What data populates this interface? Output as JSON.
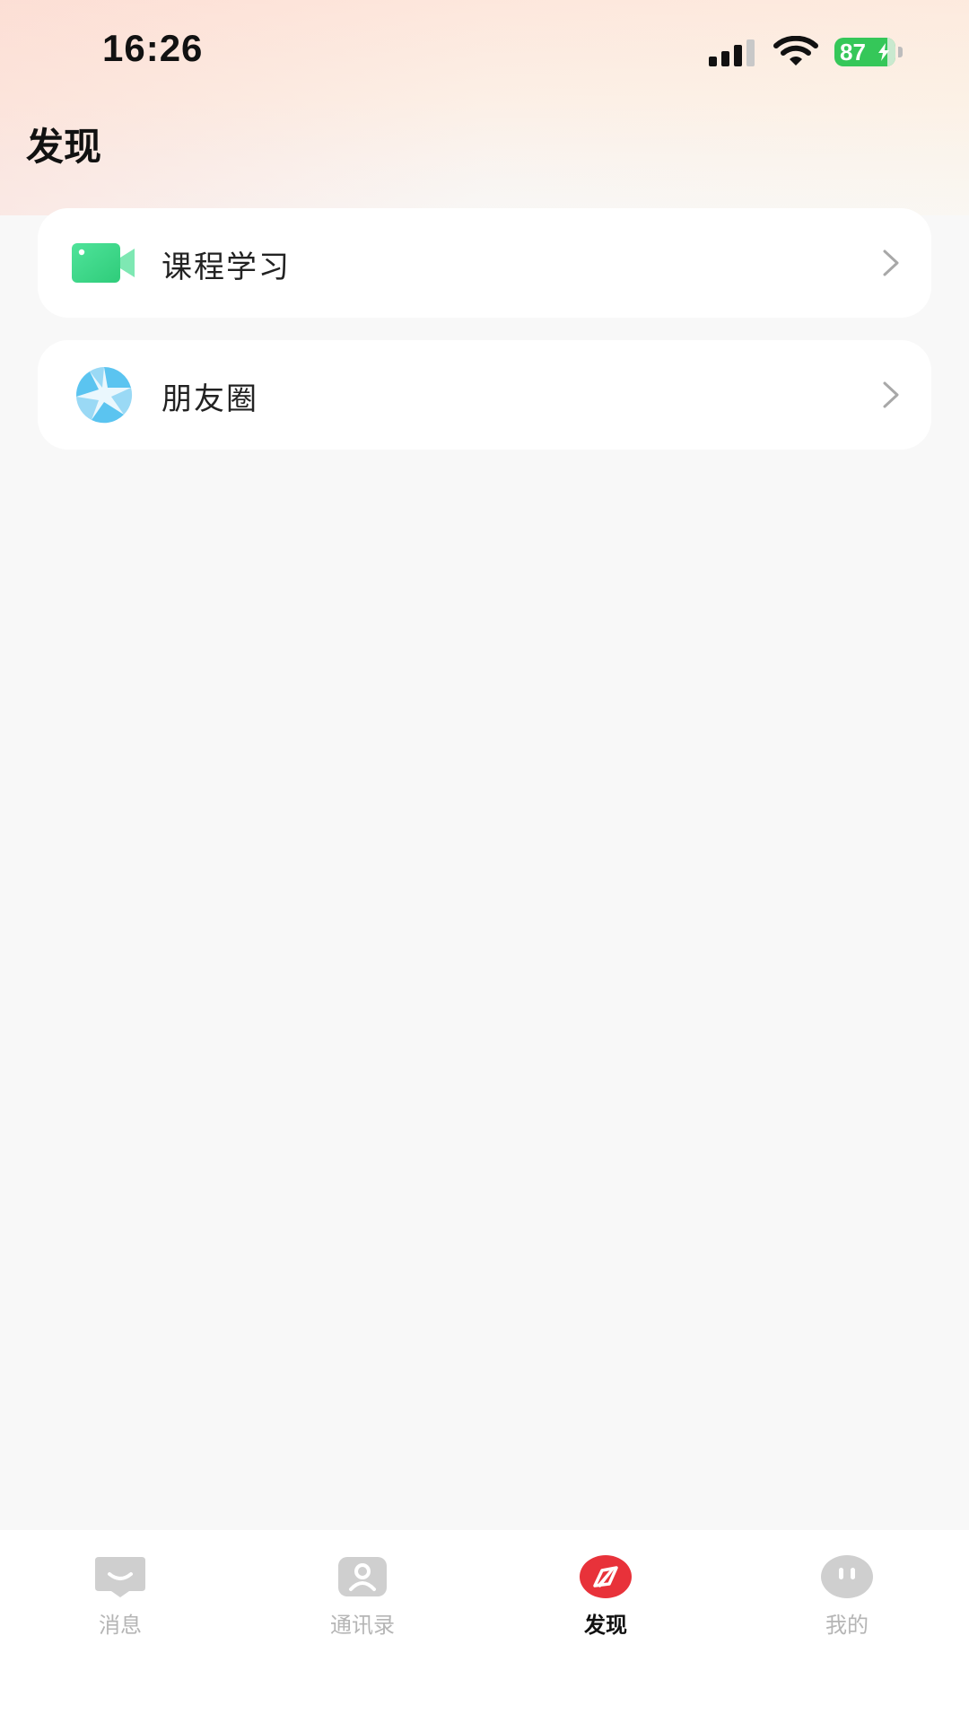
{
  "status_bar": {
    "time": "16:26",
    "battery_level": "87",
    "battery_fraction": 0.87,
    "signal_bars_filled": 3,
    "signal_bars_total": 4,
    "battery_color": "#35c759"
  },
  "page": {
    "title": "发现"
  },
  "menu": {
    "items": [
      {
        "label": "课程学习",
        "icon": "video-camera-icon",
        "icon_color": "#3dd68c"
      },
      {
        "label": "朋友圈",
        "icon": "aperture-icon",
        "icon_color": "#5bc4f0"
      }
    ]
  },
  "tab_bar": {
    "tabs": [
      {
        "label": "消息",
        "icon": "chat-bubble-icon",
        "active": false
      },
      {
        "label": "通讯录",
        "icon": "contacts-icon",
        "active": false
      },
      {
        "label": "发现",
        "icon": "compass-icon",
        "active": true
      },
      {
        "label": "我的",
        "icon": "profile-face-icon",
        "active": false
      }
    ],
    "active_color": "#e8323a",
    "inactive_color": "#cfcfcf"
  }
}
